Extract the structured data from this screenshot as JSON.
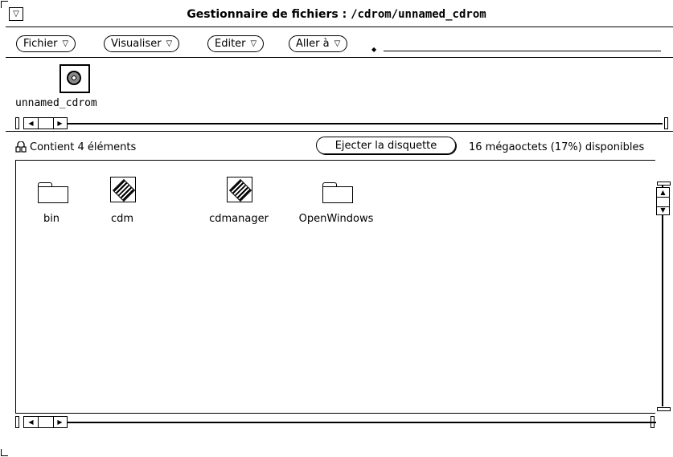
{
  "title": {
    "prefix": "Gestionnaire de fichiers : ",
    "path": "/cdrom/unnamed_cdrom"
  },
  "window_menu_glyph": "▽",
  "menus": [
    {
      "label": "Fichier",
      "glyph": "▽"
    },
    {
      "label": "Visualiser",
      "glyph": "▽"
    },
    {
      "label": "Editer",
      "glyph": "▽"
    },
    {
      "label": "Aller à",
      "glyph": "▽"
    }
  ],
  "path_pane": {
    "icon": "cdrom-icon",
    "label": "unnamed_cdrom"
  },
  "status": {
    "icon": "lock-icon",
    "text": "Contient 4 éléments",
    "eject_label": "Ejecter la disquette",
    "available": "16 mégaoctets (17%) disponibles"
  },
  "files": [
    {
      "name": "bin",
      "icon": "folder-icon"
    },
    {
      "name": "cdm",
      "icon": "application-icon"
    },
    {
      "name": "cdmanager",
      "icon": "application-icon"
    },
    {
      "name": "OpenWindows",
      "icon": "folder-icon"
    }
  ]
}
